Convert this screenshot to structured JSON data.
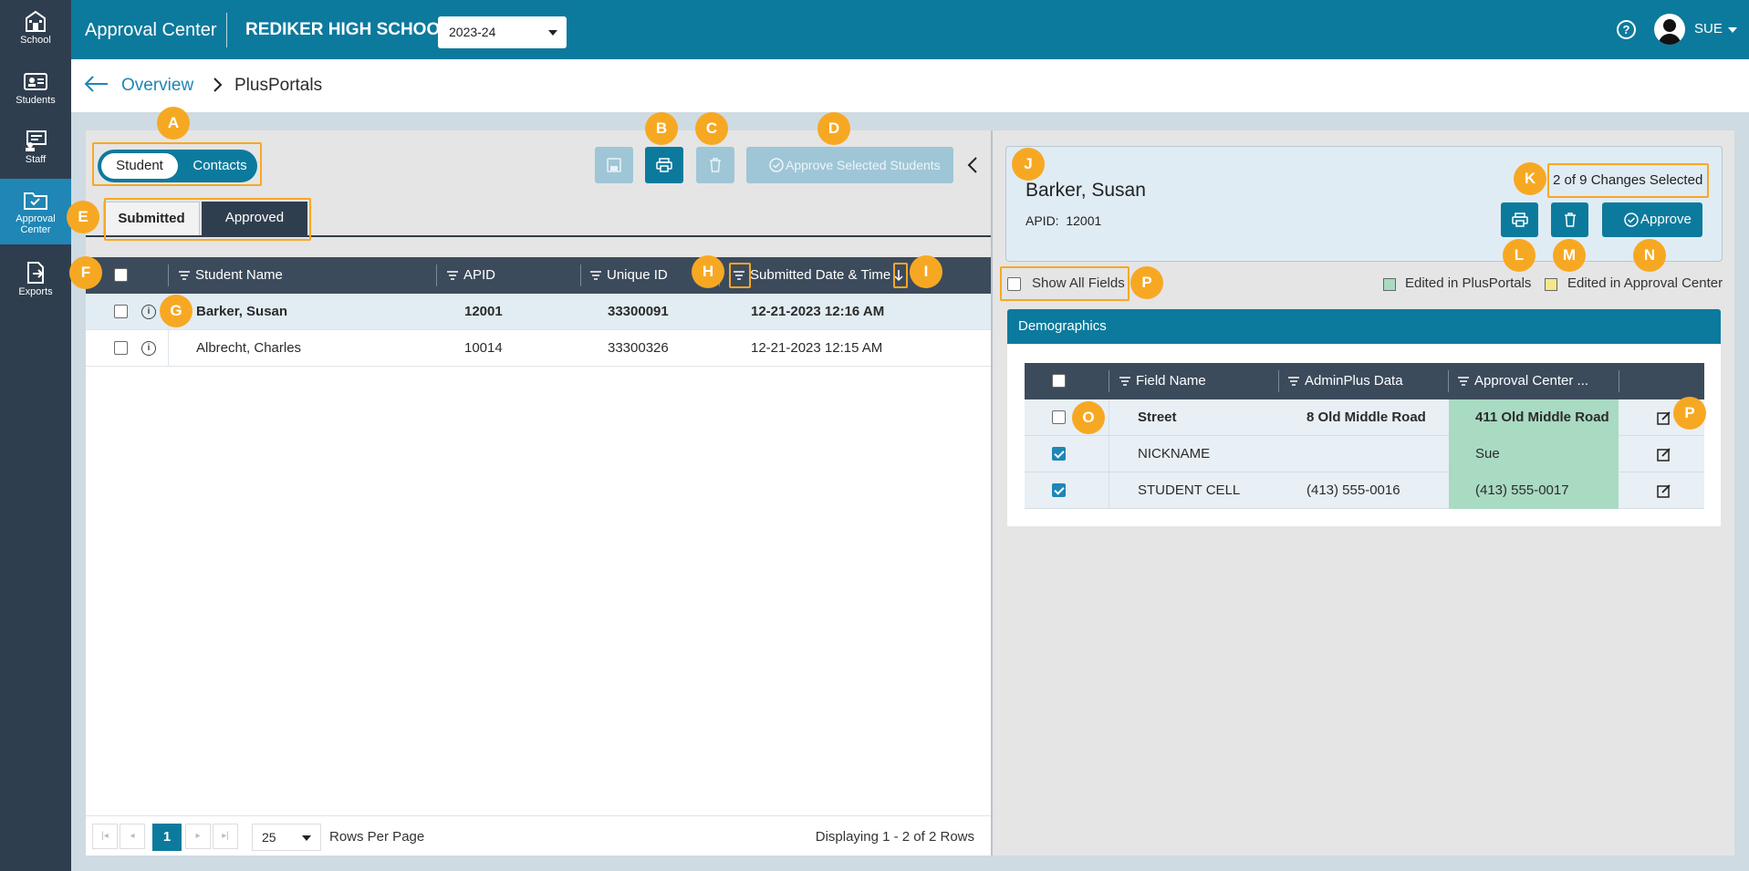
{
  "rail": {
    "items": [
      {
        "label": "School",
        "icon": "school-icon"
      },
      {
        "label": "Students",
        "icon": "students-icon"
      },
      {
        "label": "Staff",
        "icon": "staff-icon"
      },
      {
        "label": "Approval Center",
        "icon": "approval-center-icon",
        "active": true
      },
      {
        "label": "Exports",
        "icon": "exports-icon"
      }
    ]
  },
  "topbar": {
    "app_title": "Approval Center",
    "school": "REDIKER HIGH SCHOOL",
    "year": "2023-24",
    "help": "?",
    "user": "SUE"
  },
  "breadcrumb": {
    "link": "Overview",
    "current": "PlusPortals"
  },
  "left": {
    "toggle": {
      "on": "Student",
      "off": "Contacts"
    },
    "approve_selected": "Approve Selected Students",
    "tabs": {
      "submitted": "Submitted",
      "approved": "Approved"
    },
    "columns": [
      "Student Name",
      "APID",
      "Unique ID",
      "Submitted Date & Time"
    ],
    "rows": [
      {
        "name": "Barker, Susan",
        "apid": "12001",
        "unique_id": "33300091",
        "submitted": "12-21-2023 12:16 AM"
      },
      {
        "name": "Albrecht, Charles",
        "apid": "10014",
        "unique_id": "33300326",
        "submitted": "12-21-2023 12:15 AM"
      }
    ],
    "pager": {
      "page": "1",
      "page_size": "25",
      "rows_per_page": "Rows Per Page",
      "display": "Displaying 1 - 2 of 2 Rows"
    }
  },
  "detail": {
    "name": "Barker, Susan",
    "apid_label": "APID:",
    "apid": "12001",
    "changes": "2 of 9 Changes Selected",
    "approve": "Approve",
    "show_all": "Show All Fields",
    "legend_pp": "Edited in PlusPortals",
    "legend_ac": "Edited in Approval Center",
    "legend_pp_color": "#a9dac2",
    "legend_ac_color": "#f4e98a",
    "section": "Demographics",
    "columns": [
      "Field Name",
      "AdminPlus Data",
      "Approval Center ..."
    ],
    "fields": [
      {
        "name": "Street",
        "adminplus": "8 Old Middle Road",
        "approval": "411 Old Middle Road",
        "checked": false
      },
      {
        "name": "NICKNAME",
        "adminplus": "",
        "approval": "Sue",
        "checked": true
      },
      {
        "name": "STUDENT CELL",
        "adminplus": "(413) 555-0016",
        "approval": "(413) 555-0017",
        "checked": true
      }
    ]
  },
  "callouts": [
    "A",
    "B",
    "C",
    "D",
    "E",
    "F",
    "G",
    "H",
    "I",
    "J",
    "K",
    "L",
    "M",
    "N",
    "O",
    "P",
    "P"
  ],
  "colors": {
    "primary": "#0c7a9d",
    "rail": "#2f3e4e",
    "callout": "#f7a823"
  }
}
